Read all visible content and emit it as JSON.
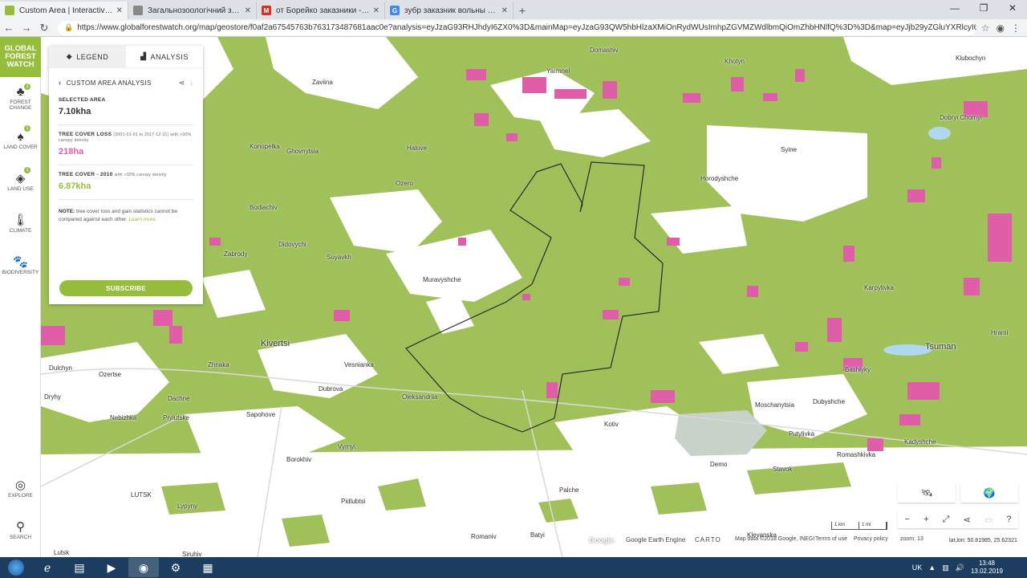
{
  "browser": {
    "tabs": [
      {
        "title": "Custom Area | Interactive Map | Global Forest Watch",
        "icon": "gfw-favicon",
        "color": "#97bd3d",
        "active": true
      },
      {
        "title": "Загальнозоологічний заказник",
        "icon": "doc-favicon",
        "color": "#888888",
        "active": false
      },
      {
        "title": "от Борейко заказники - oleksandr",
        "icon": "gmail-favicon",
        "color": "#d93025",
        "active": false
      },
      {
        "title": "зубр заказник вольны - Поиск в Google",
        "icon": "google-favicon",
        "color": "#4285f4",
        "active": false
      }
    ],
    "url": "https://www.globalforestwatch.org/map/geostore/f0af2a67545763b763173487681aac0e?analysis=eyJzaG93RHJhdyI6ZX0%3D&mainMap=eyJzaG93QW5hbHlzaXMiOnRydWUsImhpZGVMZWdlbmQiOmZhbHNlfQ%3D%3D&map=eyJjb29yZGluYXRlcyI6eyJ6b29tIjoxMiwiY2VudGVyIjp7Im..."
  },
  "rail": {
    "logo": [
      "GLOBAL",
      "FOREST",
      "WATCH"
    ],
    "items": [
      {
        "label": "FOREST CHANGE",
        "icon": "forest-change-icon",
        "glyph": "♣",
        "badge": "1"
      },
      {
        "label": "LAND COVER",
        "icon": "land-cover-icon",
        "glyph": "♠",
        "badge": "1"
      },
      {
        "label": "LAND USE",
        "icon": "land-use-icon",
        "glyph": "◈",
        "badge": "1"
      },
      {
        "label": "CLIMATE",
        "icon": "climate-icon",
        "glyph": "🌡",
        "badge": ""
      },
      {
        "label": "BIODIVERSITY",
        "icon": "biodiversity-icon",
        "glyph": "🐾",
        "badge": ""
      }
    ],
    "explore": "EXPLORE",
    "search": "SEARCH"
  },
  "panel": {
    "tab_legend": "LEGEND",
    "tab_analysis": "ANALYSIS",
    "title": "CUSTOM AREA ANALYSIS",
    "selected_label": "SELECTED AREA",
    "selected_value": "7.10kha",
    "loss_label": "TREE COVER LOSS",
    "loss_sub": "(2001-01-01 to 2017-12-31) with >30% canopy density",
    "loss_value": "218ha",
    "cover_label": "TREE COVER - 2010",
    "cover_sub": "with >30% canopy density",
    "cover_value": "6.87kha",
    "note_bold": "NOTE:",
    "note_text": "tree cover loss and gain statistics cannot be compared against each other.",
    "note_link": "Learn more.",
    "subscribe": "SUBSCRIBE"
  },
  "places": [
    {
      "name": "Domashiv"
    },
    {
      "name": "Khotyn"
    },
    {
      "name": "Klubochyn"
    },
    {
      "name": "Yarmnel"
    },
    {
      "name": "Zaviina"
    },
    {
      "name": "Konopelka"
    },
    {
      "name": "Ghovnytsia"
    },
    {
      "name": "Halove"
    },
    {
      "name": "Syine"
    },
    {
      "name": "Horodyshche"
    },
    {
      "name": "Ozero"
    },
    {
      "name": "Bodiachiv"
    },
    {
      "name": "Dobryi Chornyi"
    },
    {
      "name": "Didovychi"
    },
    {
      "name": "Zabrody"
    },
    {
      "name": "Suyavkh"
    },
    {
      "name": "Muravyshche"
    },
    {
      "name": "Karpylivka"
    },
    {
      "name": "Hrami"
    },
    {
      "name": "Kivertsi"
    },
    {
      "name": "Tsuman"
    },
    {
      "name": "Bashlyky"
    },
    {
      "name": "Zhnaka"
    },
    {
      "name": "Vesnianka"
    },
    {
      "name": "Dulchyn"
    },
    {
      "name": "Ozertse"
    },
    {
      "name": "Dubrova"
    },
    {
      "name": "Oleksandriia"
    },
    {
      "name": "Dryhy"
    },
    {
      "name": "Dachne"
    },
    {
      "name": "Moschanytsia"
    },
    {
      "name": "Dubyshche"
    },
    {
      "name": "Nebizhka"
    },
    {
      "name": "Prylutske"
    },
    {
      "name": "Sapohove"
    },
    {
      "name": "Kotiv"
    },
    {
      "name": "Putylivka"
    },
    {
      "name": "Kadyshche"
    },
    {
      "name": "Vyrnyi"
    },
    {
      "name": "Romashkivka"
    },
    {
      "name": "Borokhiv"
    },
    {
      "name": "Demo"
    },
    {
      "name": "Stavok"
    },
    {
      "name": "LUTSK"
    },
    {
      "name": "Pidlubtsi"
    },
    {
      "name": "Palche"
    },
    {
      "name": "Lypyny"
    },
    {
      "name": "Romaniv"
    },
    {
      "name": "Batyi"
    },
    {
      "name": "Klevanska"
    },
    {
      "name": "Lutsk"
    },
    {
      "name": "Siruhiv"
    }
  ],
  "controls": {
    "zoom_out": "−",
    "zoom_in": "+",
    "attribution_google": "Google",
    "attribution_engine": "Google Earth Engine",
    "attribution_carto": "CARTO",
    "attribution_map": "Map data ©2018 Google, INEGI",
    "terms": "Terms of use",
    "privacy": "Privacy policy",
    "zoom": "zoom: 13",
    "coords": "lat,lon: 50.81985, 25.62321",
    "scale_1": "1 km",
    "scale_2": "1 mi"
  },
  "taskbar": {
    "lang": "UK",
    "time": "13:48",
    "date": "13.02.2019"
  },
  "colors": {
    "forest": "#a0c15a",
    "loss": "#e05ea8",
    "accent": "#97bd3d",
    "clearing": "#ffffff"
  }
}
